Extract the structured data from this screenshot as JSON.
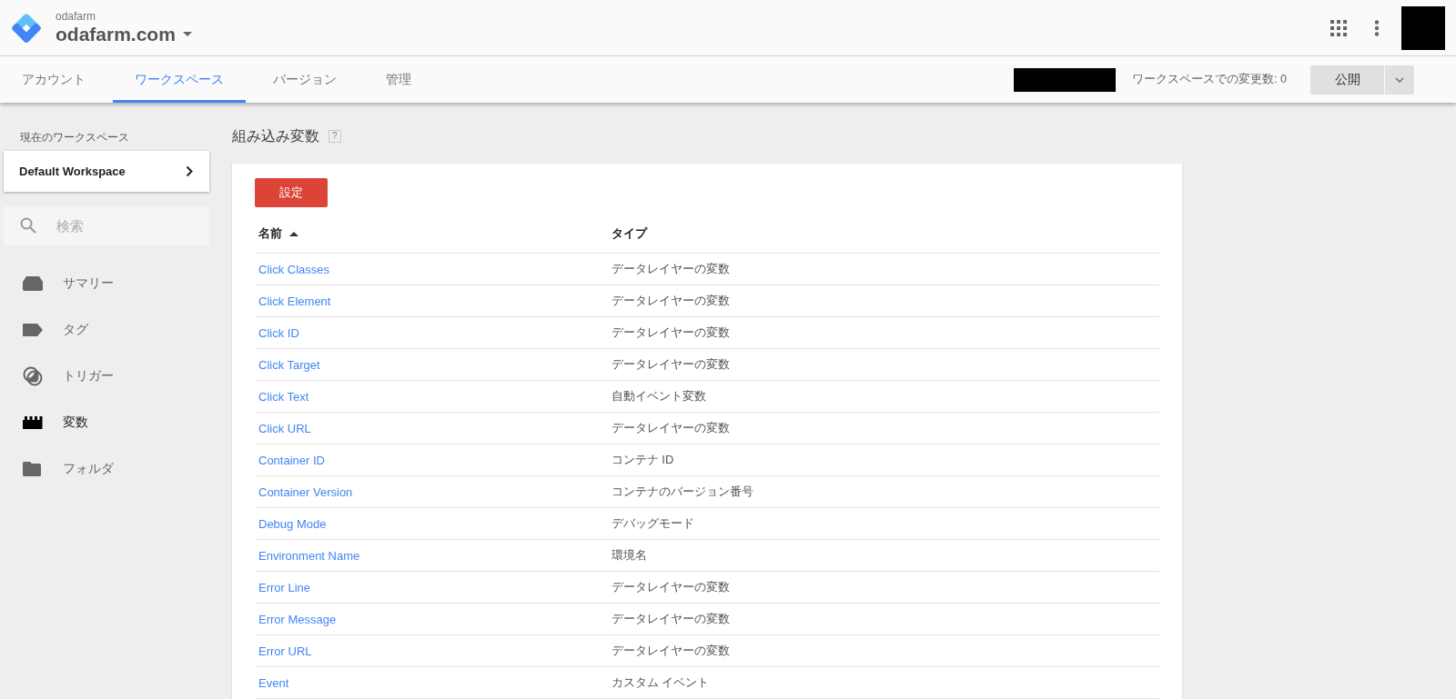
{
  "header": {
    "account": "odafarm",
    "container": "odafarm.com"
  },
  "tabs": [
    {
      "label": "アカウント",
      "selected": false
    },
    {
      "label": "ワークスペース",
      "selected": true
    },
    {
      "label": "バージョン",
      "selected": false
    },
    {
      "label": "管理",
      "selected": false
    }
  ],
  "toolbar": {
    "changes": "ワークスペースでの変更数: 0",
    "publish": "公開"
  },
  "sidebar": {
    "workspace_label": "現在のワークスペース",
    "workspace": "Default Workspace",
    "search": {
      "placeholder": "検索"
    },
    "items": [
      {
        "kind": "summary",
        "label": "サマリー",
        "selected": false
      },
      {
        "kind": "tag",
        "label": "タグ",
        "selected": false
      },
      {
        "kind": "trigger",
        "label": "トリガー",
        "selected": false
      },
      {
        "kind": "variable",
        "label": "変数",
        "selected": true
      },
      {
        "kind": "folder",
        "label": "フォルダ",
        "selected": false
      }
    ]
  },
  "main": {
    "title": "組み込み変数",
    "help": "?",
    "configure": "設定",
    "table": {
      "columns": [
        "名前",
        "タイプ"
      ],
      "rows": [
        [
          "Click Classes",
          "データレイヤーの変数"
        ],
        [
          "Click Element",
          "データレイヤーの変数"
        ],
        [
          "Click ID",
          "データレイヤーの変数"
        ],
        [
          "Click Target",
          "データレイヤーの変数"
        ],
        [
          "Click Text",
          "自動イベント変数"
        ],
        [
          "Click URL",
          "データレイヤーの変数"
        ],
        [
          "Container ID",
          "コンテナ ID"
        ],
        [
          "Container Version",
          "コンテナのバージョン番号"
        ],
        [
          "Debug Mode",
          "デバッグモード"
        ],
        [
          "Environment Name",
          "環境名"
        ],
        [
          "Error Line",
          "データレイヤーの変数"
        ],
        [
          "Error Message",
          "データレイヤーの変数"
        ],
        [
          "Error URL",
          "データレイヤーの変数"
        ],
        [
          "Event",
          "カスタム イベント"
        ]
      ]
    }
  }
}
